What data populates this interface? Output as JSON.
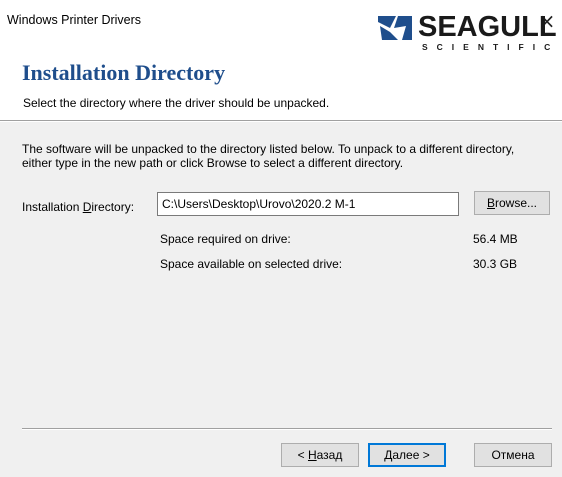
{
  "window": {
    "title": "Windows Printer Drivers",
    "close_glyph": "×"
  },
  "header": {
    "heading": "Installation Directory",
    "subheading": "Select the directory where the driver should be unpacked.",
    "logo": {
      "wordmark": "SEAGULL",
      "subtitle": "SCIENTIFIC",
      "icon": "seagull-logo-icon",
      "color": "#1f4e8c"
    }
  },
  "body": {
    "description_line1": "The software will be unpacked to the directory listed below.  To unpack to a different directory,",
    "description_line2": "either type in the new path or click Browse to select a different directory.",
    "dir_label_pre": "Installation ",
    "dir_label_accel": "D",
    "dir_label_post": "irectory:",
    "dir_value": "C:\\Users\\Desktop\\Urovo\\2020.2 M-1",
    "browse_accel": "B",
    "browse_rest": "rowse...",
    "space_required_label": "Space required on drive:",
    "space_required_value": "56.4 MB",
    "space_available_label": "Space available on selected drive:",
    "space_available_value": "30.3 GB"
  },
  "footer": {
    "back_pre": "< ",
    "back_accel": "Н",
    "back_rest": "азад",
    "next_accel": "Д",
    "next_rest": "алее >",
    "cancel_label": "Отмена"
  }
}
